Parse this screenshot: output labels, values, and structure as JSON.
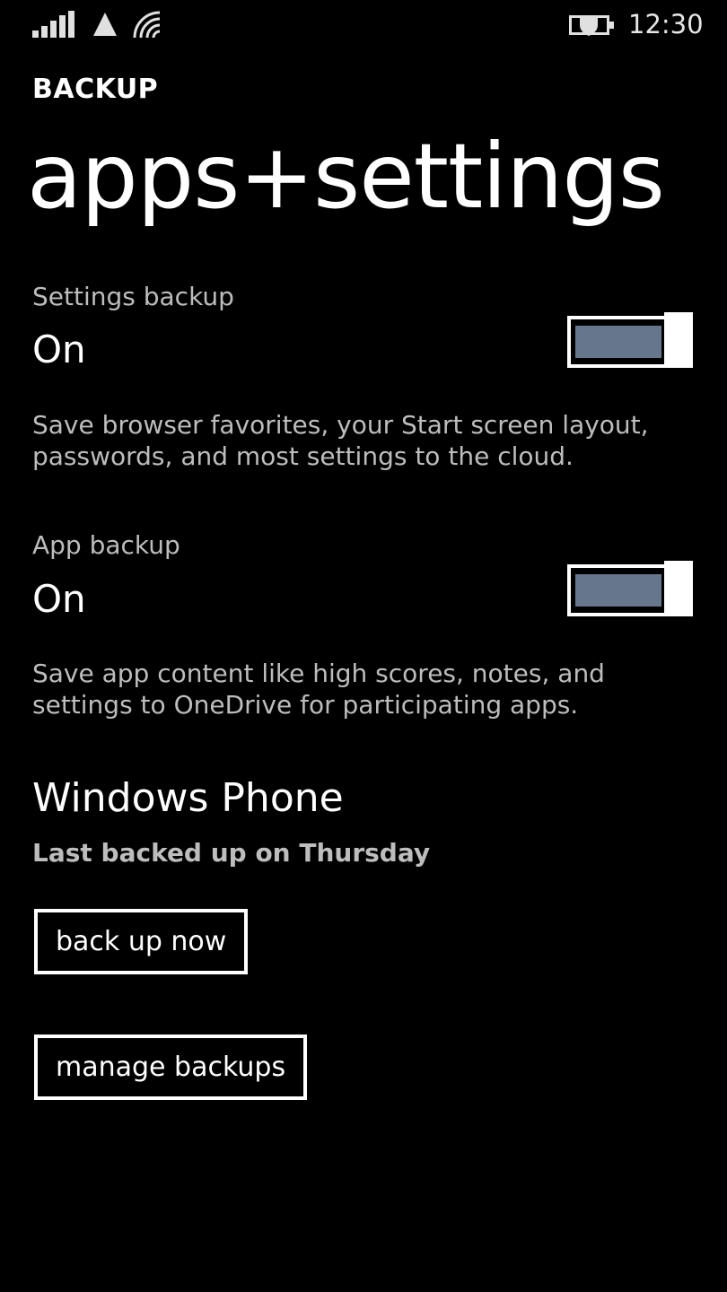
{
  "status_bar": {
    "time": "12:30",
    "icons": [
      "signal-strength-icon",
      "network-triangle-icon",
      "wifi-icon",
      "battery-saver-icon"
    ]
  },
  "header": {
    "app_title": "BACKUP",
    "page_title": "apps+settings"
  },
  "settings": [
    {
      "label": "Settings backup",
      "value": "On",
      "enabled": true,
      "description": "Save browser favorites, your Start screen layout, passwords, and most settings to the cloud."
    },
    {
      "label": "App backup",
      "value": "On",
      "enabled": true,
      "description": "Save app content like high scores, notes, and settings to OneDrive for participating apps."
    }
  ],
  "device": {
    "name": "Windows Phone",
    "last_backup": "Last backed up on Thursday"
  },
  "buttons": {
    "back_up_now": "back up now",
    "manage_backups": "manage backups"
  },
  "colors": {
    "background": "#000000",
    "foreground": "#ffffff",
    "secondary_text": "#bdbdbd",
    "toggle_accent": "#66778d"
  }
}
